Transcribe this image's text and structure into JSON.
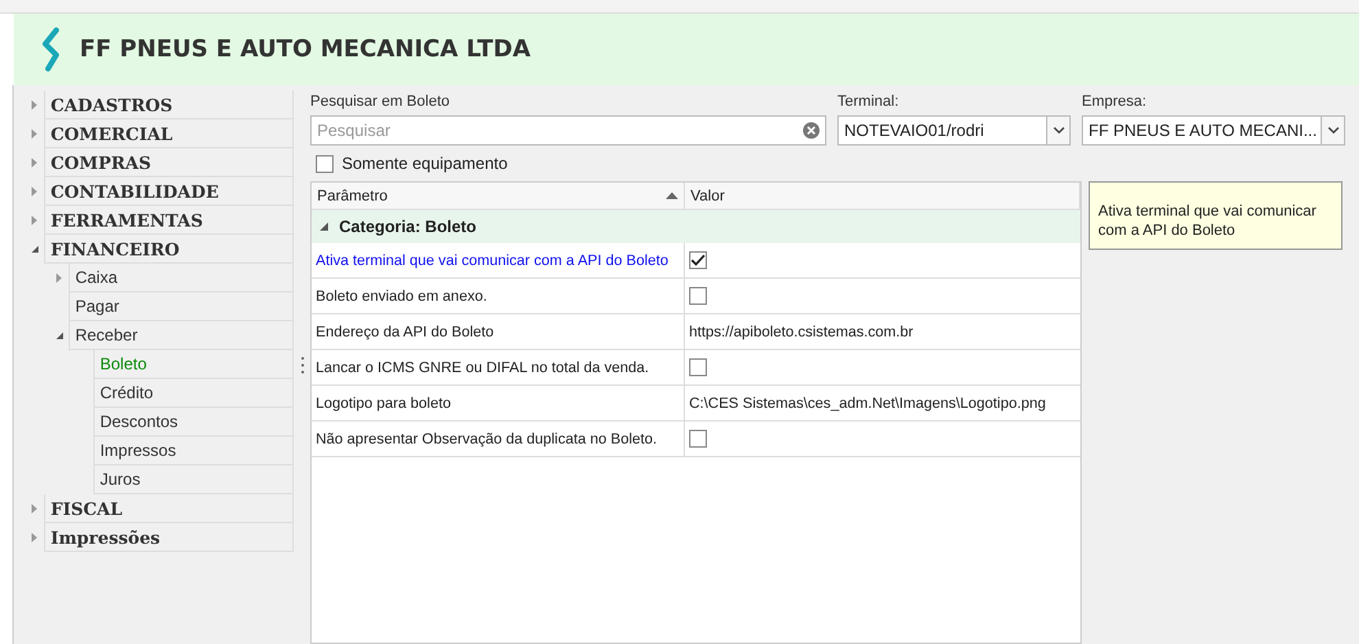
{
  "header": {
    "title": "FF PNEUS E AUTO MECANICA LTDA"
  },
  "tree": [
    {
      "label": "CADASTROS",
      "expanded": false,
      "selected": false
    },
    {
      "label": "COMERCIAL",
      "expanded": false,
      "selected": false
    },
    {
      "label": "COMPRAS",
      "expanded": false,
      "selected": false
    },
    {
      "label": "CONTABILIDADE",
      "expanded": false,
      "selected": false
    },
    {
      "label": "FERRAMENTAS",
      "expanded": false,
      "selected": false
    },
    {
      "label": "FINANCEIRO",
      "expanded": true,
      "selected": false,
      "children": [
        {
          "label": "Caixa",
          "expanded": false,
          "selected": false
        },
        {
          "label": "Pagar",
          "selected": false
        },
        {
          "label": "Receber",
          "expanded": true,
          "selected": false,
          "children": [
            {
              "label": "Boleto",
              "selected": true
            },
            {
              "label": "Crédito",
              "selected": false
            },
            {
              "label": "Descontos",
              "selected": false
            },
            {
              "label": "Impressos",
              "selected": false
            },
            {
              "label": "Juros",
              "selected": false
            }
          ]
        }
      ]
    },
    {
      "label": "FISCAL",
      "expanded": false,
      "selected": false
    },
    {
      "label": "Impressões",
      "expanded": false,
      "selected": false
    }
  ],
  "search": {
    "label": "Pesquisar em Boleto",
    "placeholder": "Pesquisar"
  },
  "terminal": {
    "label": "Terminal:",
    "value": "NOTEVAIO01/rodri"
  },
  "empresa": {
    "label": "Empresa:",
    "value": "FF PNEUS E AUTO MECANI..."
  },
  "filter": {
    "label": "Somente equipamento",
    "checked": false
  },
  "grid": {
    "columns": [
      "Parâmetro",
      "Valor"
    ],
    "category": "Categoria: Boleto",
    "rows": [
      {
        "name": "Ativa terminal que vai comunicar com a API do Boleto",
        "kind": "bool",
        "checked": true,
        "selected": true
      },
      {
        "name": "Boleto enviado em anexo.",
        "kind": "bool",
        "checked": false,
        "selected": false
      },
      {
        "name": "Endereço da API do Boleto",
        "kind": "text",
        "value": "https://apiboleto.csistemas.com.br",
        "selected": false
      },
      {
        "name": "Lancar o ICMS GNRE ou DIFAL no total da venda.",
        "kind": "bool",
        "checked": false,
        "selected": false
      },
      {
        "name": "Logotipo para boleto",
        "kind": "text",
        "value": "C:\\CES Sistemas\\ces_adm.Net\\Imagens\\Logotipo.png",
        "selected": false
      },
      {
        "name": "Não apresentar Observação da duplicata no Boleto.",
        "kind": "bool",
        "checked": false,
        "selected": false
      }
    ]
  },
  "description": "Ativa terminal que vai comunicar com a API do Boleto"
}
